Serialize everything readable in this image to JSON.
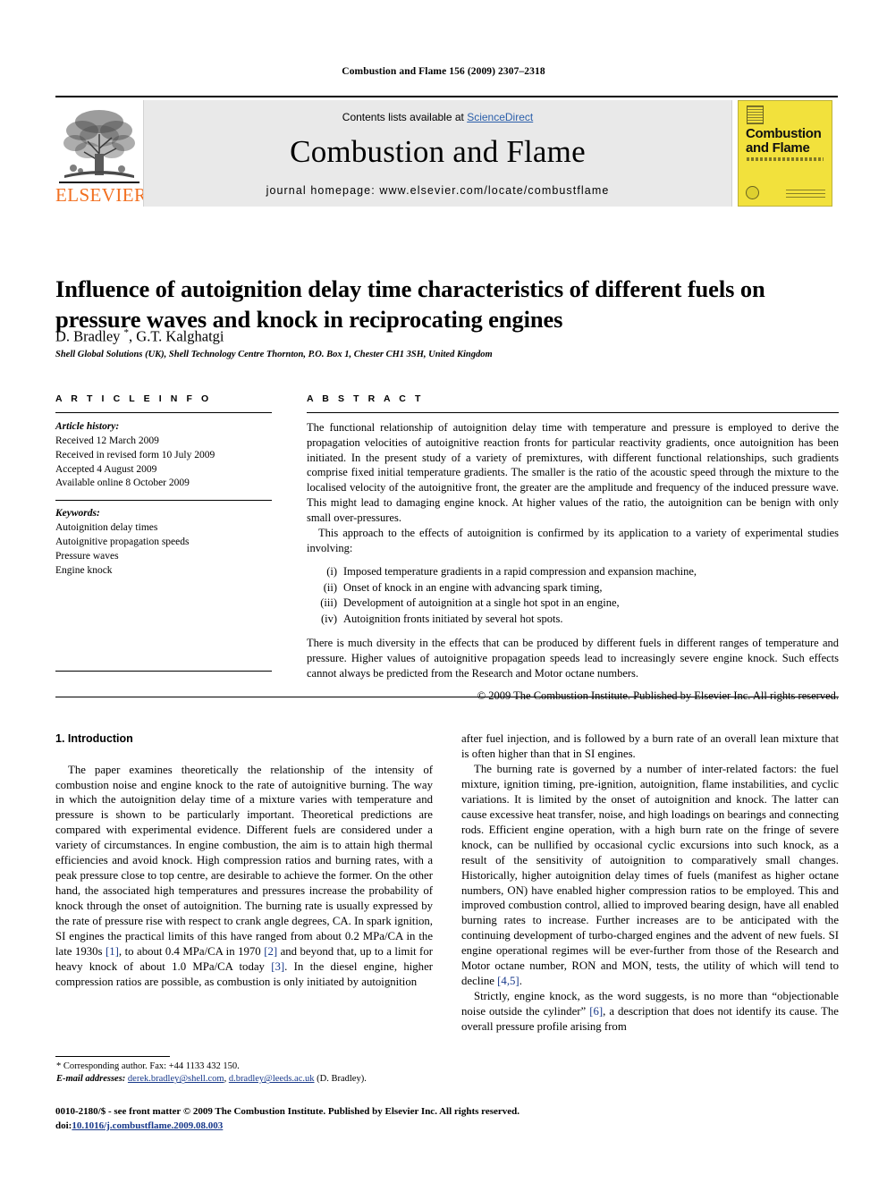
{
  "running_head": "Combustion and Flame 156 (2009) 2307–2318",
  "masthead": {
    "publisher_name": "ELSEVIER",
    "contents_prefix": "Contents lists available at ",
    "contents_link": "ScienceDirect",
    "journal_title": "Combustion and Flame",
    "homepage": "journal homepage: www.elsevier.com/locate/combustflame",
    "cover": {
      "line1": "Combustion",
      "line2": "and Flame"
    }
  },
  "article": {
    "title": "Influence of autoignition delay time characteristics of different fuels on pressure waves and knock in reciprocating engines",
    "authors": "D. Bradley ",
    "author_mark": "*",
    "authors_rest": ", G.T. Kalghatgi",
    "affiliation": "Shell Global Solutions (UK), Shell Technology Centre Thornton, P.O. Box 1, Chester CH1 3SH, United Kingdom"
  },
  "article_info": {
    "heading": "A R T I C L E   I N F O",
    "history_label": "Article history:",
    "history": [
      "Received 12 March 2009",
      "Received in revised form 10 July 2009",
      "Accepted 4 August 2009",
      "Available online 8 October 2009"
    ],
    "keywords_label": "Keywords:",
    "keywords": [
      "Autoignition delay times",
      "Autoignitive propagation speeds",
      "Pressure waves",
      "Engine knock"
    ]
  },
  "abstract": {
    "heading": "A B S T R A C T",
    "paragraph1": "The functional relationship of autoignition delay time with temperature and pressure is employed to derive the propagation velocities of autoignitive reaction fronts for particular reactivity gradients, once autoignition has been initiated. In the present study of a variety of premixtures, with different functional relationships, such gradients comprise fixed initial temperature gradients. The smaller is the ratio of the acoustic speed through the mixture to the localised velocity of the autoignitive front, the greater are the amplitude and frequency of the induced pressure wave. This might lead to damaging engine knock. At higher values of the ratio, the autoignition can be benign with only small over-pressures.",
    "paragraph2": "This approach to the effects of autoignition is confirmed by its application to a variety of experimental studies involving:",
    "list": [
      {
        "num": "(i)",
        "text": "Imposed temperature gradients in a rapid compression and expansion machine,"
      },
      {
        "num": "(ii)",
        "text": "Onset of knock in an engine with advancing spark timing,"
      },
      {
        "num": "(iii)",
        "text": "Development of autoignition at a single hot spot in an engine,"
      },
      {
        "num": "(iv)",
        "text": "Autoignition fronts initiated by several hot spots."
      }
    ],
    "paragraph3": "There is much diversity in the effects that can be produced by different fuels in different ranges of temperature and pressure. Higher values of autoignitive propagation speeds lead to increasingly severe engine knock. Such effects cannot always be predicted from the Research and Motor octane numbers.",
    "copyright": "© 2009 The Combustion Institute. Published by Elsevier Inc. All rights reserved."
  },
  "body": {
    "section_title": "1. Introduction",
    "left": {
      "p1_a": "The paper examines theoretically the relationship of the intensity of combustion noise and engine knock to the rate of autoignitive burning. The way in which the autoignition delay time of a mixture varies with temperature and pressure is shown to be particularly important. Theoretical predictions are compared with experimental evidence. Different fuels are considered under a variety of circumstances. In engine combustion, the aim is to attain high thermal efficiencies and avoid knock. High compression ratios and burning rates, with a peak pressure close to top centre, are desirable to achieve the former. On the other hand, the associated high temperatures and pressures increase the probability of knock through the onset of autoignition. The burning rate is usually expressed by the rate of pressure rise with respect to crank angle degrees, CA. In spark ignition, SI engines the practical limits of this have ranged from about 0.2 MPa/CA in the late 1930s ",
      "ref1": "[1]",
      "p1_b": ", to about 0.4 MPa/CA in 1970 ",
      "ref2": "[2]",
      "p1_c": " and beyond that, up to a limit for heavy knock of about 1.0 MPa/CA today ",
      "ref3": "[3]",
      "p1_d": ". In the diesel engine, higher compression ratios are possible, as combustion is only initiated by autoignition"
    },
    "right": {
      "p1": "after fuel injection, and is followed by a burn rate of an overall lean mixture that is often higher than that in SI engines.",
      "p2_a": "The burning rate is governed by a number of inter-related factors: the fuel mixture, ignition timing, pre-ignition, autoignition, flame instabilities, and cyclic variations. It is limited by the onset of autoignition and knock. The latter can cause excessive heat transfer, noise, and high loadings on bearings and connecting rods. Efficient engine operation, with a high burn rate on the fringe of severe knock, can be nullified by occasional cyclic excursions into such knock, as a result of the sensitivity of autoignition to comparatively small changes. Historically, higher autoignition delay times of fuels (manifest as higher octane numbers, ON) have enabled higher compression ratios to be employed. This and improved combustion control, allied to improved bearing design, have all enabled burning rates to increase. Further increases are to be anticipated with the continuing development of turbo-charged engines and the advent of new fuels. SI engine operational regimes will be ever-further from those of the Research and Motor octane number, RON and MON, tests, the utility of which will tend to decline ",
      "ref45": "[4,5]",
      "p2_b": ".",
      "p3_a": "Strictly, engine knock, as the word suggests, is no more than “objectionable noise outside the cylinder” ",
      "ref6": "[6]",
      "p3_b": ", a description that does not identify its cause. The overall pressure profile arising from"
    }
  },
  "footnote": {
    "mark": "*",
    "corresponding": "Corresponding author. Fax: +44 1133 432 150.",
    "email_label": "E-mail addresses:",
    "email1": "derek.bradley@shell.com",
    "sep": ", ",
    "email2": "d.bradley@leeds.ac.uk",
    "email_tail": " (D. Bradley)."
  },
  "publisher_footer": {
    "line1": "0010-2180/$ - see front matter © 2009 The Combustion Institute. Published by Elsevier Inc. All rights reserved.",
    "doi_label": "doi:",
    "doi_value": "10.1016/j.combustflame.2009.08.003"
  },
  "colors": {
    "elsevier_orange": "#f27021",
    "link_blue": "#2b5faa",
    "reference_blue": "#17388a",
    "cover_yellow": "#f2e13c",
    "band_grey": "#e9e9e9"
  }
}
